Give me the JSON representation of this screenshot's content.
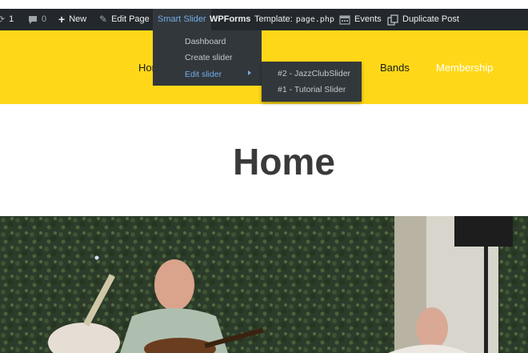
{
  "admin_bar": {
    "updates_count": "1",
    "comments_count": "0",
    "new_label": "New",
    "edit_page_label": "Edit Page",
    "smart_slider_label": "Smart Slider",
    "wpforms_label": "WPForms",
    "template_label": "Template:",
    "template_file": "page.php",
    "events_label": "Events",
    "duplicate_post_label": "Duplicate Post",
    "bg_color": "#23282d",
    "active_color": "#72aee6"
  },
  "smart_slider_menu": {
    "items": [
      "Dashboard",
      "Create slider",
      "Edit slider"
    ],
    "submenu": [
      "#2 - JazzClubSlider",
      "#1 - Tutorial Slider"
    ]
  },
  "site_nav": {
    "items": [
      "Hor",
      "Bands",
      "Membership"
    ],
    "header_color": "#fed818"
  },
  "page": {
    "title": "Home"
  }
}
